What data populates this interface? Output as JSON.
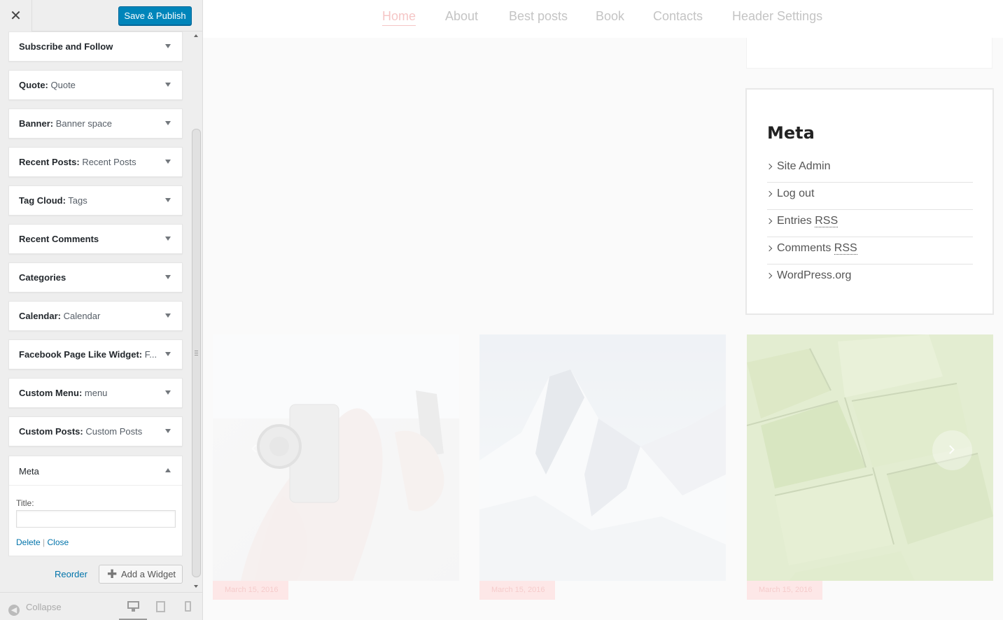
{
  "header": {
    "close_label": "✕",
    "publish_label": "Save & Publish"
  },
  "widgets": [
    {
      "name": "Subscribe and Follow",
      "subtitle": ""
    },
    {
      "name": "Quote:",
      "subtitle": " Quote"
    },
    {
      "name": "Banner:",
      "subtitle": " Banner space"
    },
    {
      "name": "Recent Posts:",
      "subtitle": " Recent Posts"
    },
    {
      "name": "Tag Cloud:",
      "subtitle": " Tags"
    },
    {
      "name": "Recent Comments",
      "subtitle": ""
    },
    {
      "name": "Categories",
      "subtitle": ""
    },
    {
      "name": "Calendar:",
      "subtitle": " Calendar"
    },
    {
      "name": "Facebook Page Like Widget:",
      "subtitle": " F..."
    },
    {
      "name": "Custom Menu:",
      "subtitle": " menu"
    },
    {
      "name": "Custom Posts:",
      "subtitle": " Custom Posts"
    }
  ],
  "meta_widget": {
    "title": "Meta",
    "field_label": "Title:",
    "field_value": "",
    "delete_label": "Delete",
    "separator": "|",
    "close_label": "Close"
  },
  "footer_actions": {
    "reorder_label": "Reorder",
    "add_widget_label": "Add a Widget"
  },
  "sidebar_footer": {
    "collapse_label": "Collapse"
  },
  "nav": [
    "Home",
    "About",
    "Best posts",
    "Book",
    "Contacts",
    "Header Settings"
  ],
  "meta_box": {
    "heading": "Meta",
    "links": [
      {
        "text": "Site Admin",
        "abbr": ""
      },
      {
        "text": "Log out",
        "abbr": ""
      },
      {
        "text": "Entries ",
        "abbr": "RSS"
      },
      {
        "text": "Comments ",
        "abbr": "RSS"
      },
      {
        "text": "WordPress.org",
        "abbr": ""
      }
    ]
  },
  "posts": [
    {
      "date": "March 15, 2016",
      "image": "camera-photo"
    },
    {
      "date": "March 15, 2016",
      "image": "mountain-photo"
    },
    {
      "date": "March 15, 2016",
      "image": "green-fields-photo"
    }
  ],
  "colors": {
    "publish_button": "#0085ba",
    "link": "#0073aa",
    "nav_active": "#f5c6c6"
  }
}
